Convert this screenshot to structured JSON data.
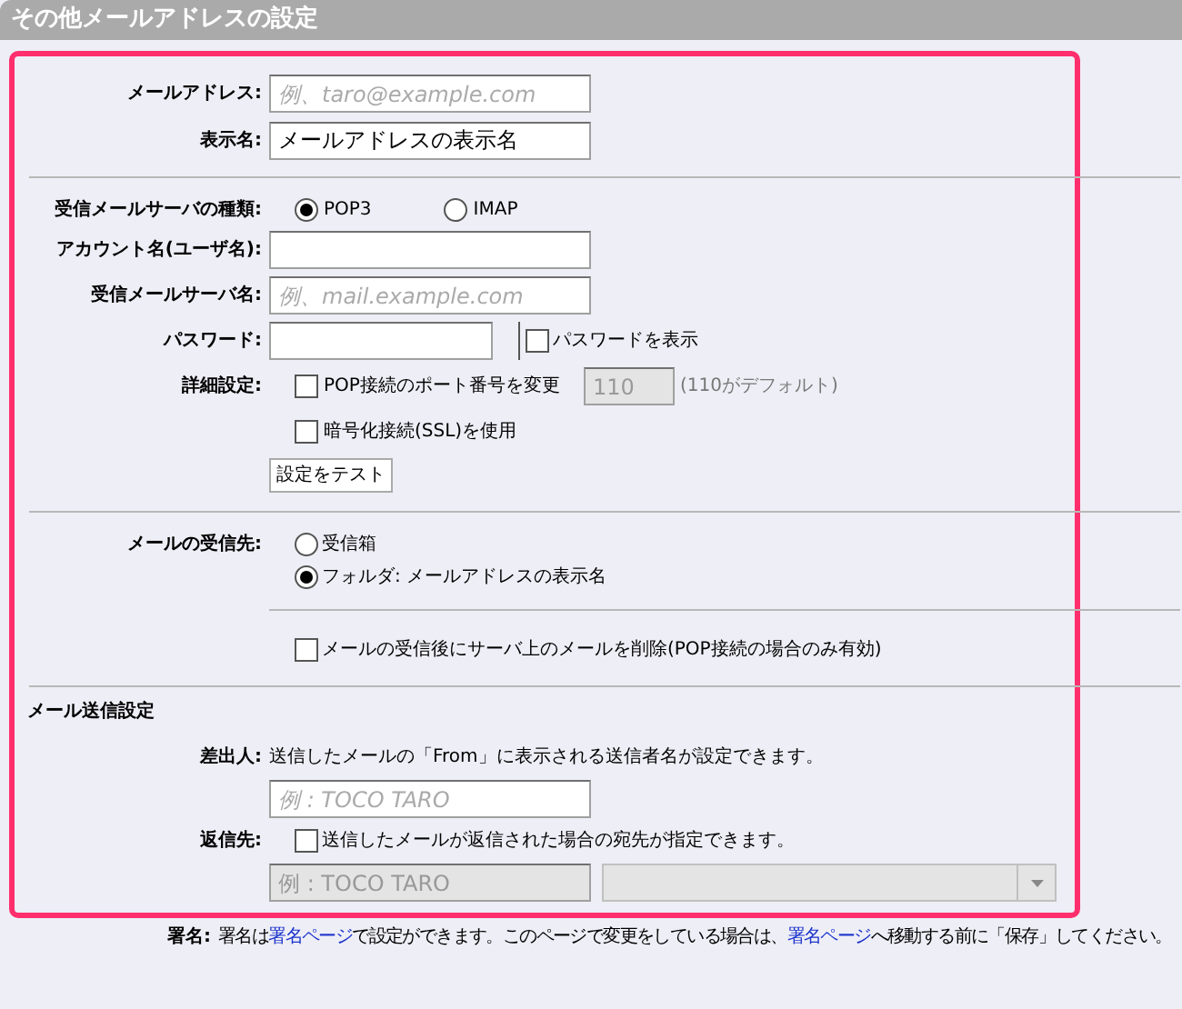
{
  "title": "その他メールアドレスの設定",
  "identity": [
    {
      "label": "メールアドレス:",
      "placeholder": "例、taro@example.com"
    },
    {
      "label": "表示名:",
      "value": "メールアドレスの表示名"
    }
  ],
  "server_type": {
    "label": "受信メールサーバの種類:",
    "options": [
      {
        "label": "POP3",
        "selected": true
      },
      {
        "label": "IMAP",
        "selected": false
      }
    ]
  },
  "account": {
    "label": "アカウント名(ユーザ名):"
  },
  "server": {
    "label": "受信メールサーバ名:",
    "placeholder": "例、mail.example.com"
  },
  "password": {
    "label": "パスワード:",
    "show": {
      "label": "パスワードを表示",
      "checked": false
    }
  },
  "advanced": {
    "label": "詳細設定:",
    "port": {
      "label": "POP接続のポート番号を変更",
      "checked": false,
      "value": "110",
      "disabled": true,
      "note": "(110がデフォルト)"
    },
    "ssl": {
      "label": "暗号化接続(SSL)を使用",
      "checked": false
    }
  },
  "test_button": "設定をテスト",
  "destination": {
    "label": "メールの受信先:",
    "options": [
      {
        "label": "受信箱",
        "selected": false
      },
      {
        "label": "フォルダ: メールアドレスの表示名",
        "selected": true
      }
    ]
  },
  "delete_after": {
    "label": "メールの受信後にサーバ上のメールを削除(POP接続の場合のみ有効)",
    "checked": false
  },
  "sending": {
    "title": "メール送信設定",
    "sender": {
      "label": "差出人:",
      "description": "送信したメールの「From」に表示される送信者名が設定できます。",
      "placeholder": "例 : TOCO TARO"
    },
    "reply_to": {
      "label": "返信先:",
      "checkbox": {
        "label": "送信したメールが返信された場合の宛先が指定できます。",
        "checked": false
      },
      "placeholder": "例 : TOCO TARO",
      "disabled": true
    }
  },
  "signature": {
    "label": "署名:",
    "parts": [
      {
        "kind": "text",
        "text": "署名は"
      },
      {
        "kind": "link",
        "text": "署名ページ"
      },
      {
        "kind": "text",
        "text": "で設定ができます。このページで変更をしている場合は、"
      },
      {
        "kind": "link",
        "text": "署名ページ"
      },
      {
        "kind": "text",
        "text": "へ移動する前に「保存」してください。"
      }
    ]
  }
}
